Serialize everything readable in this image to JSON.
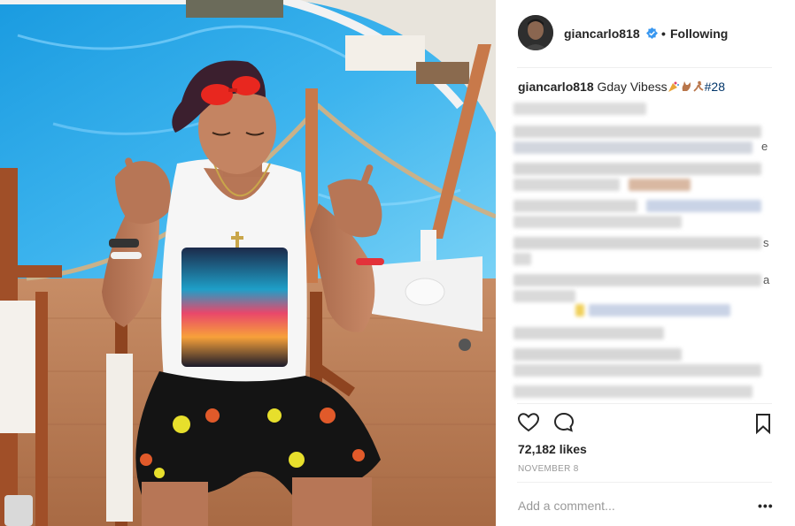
{
  "post": {
    "username": "giancarlo818",
    "follow_status": "Following",
    "separator": "•",
    "caption": {
      "username": "giancarlo818",
      "text": "Gday Vibess",
      "emoji_names": [
        "party-popper-emoji",
        "shaka-hand-emoji",
        "runner-emoji"
      ],
      "hashtag": "#28"
    },
    "likes": "72,182 likes",
    "date": "NOVEMBER 8",
    "comment_placeholder": "Add a comment...",
    "more_options": "•••",
    "blurred_fragments": [
      "e",
      "s",
      "a"
    ]
  },
  "icons": {
    "verified": "verified-badge-icon",
    "like": "heart-icon",
    "comment": "comment-bubble-icon",
    "save": "bookmark-icon",
    "more": "more-options-icon"
  },
  "colors": {
    "verified_blue": "#3897f0",
    "hashtag": "#003569",
    "text_primary": "#262626",
    "text_muted": "#999999",
    "divider": "#efefef"
  }
}
